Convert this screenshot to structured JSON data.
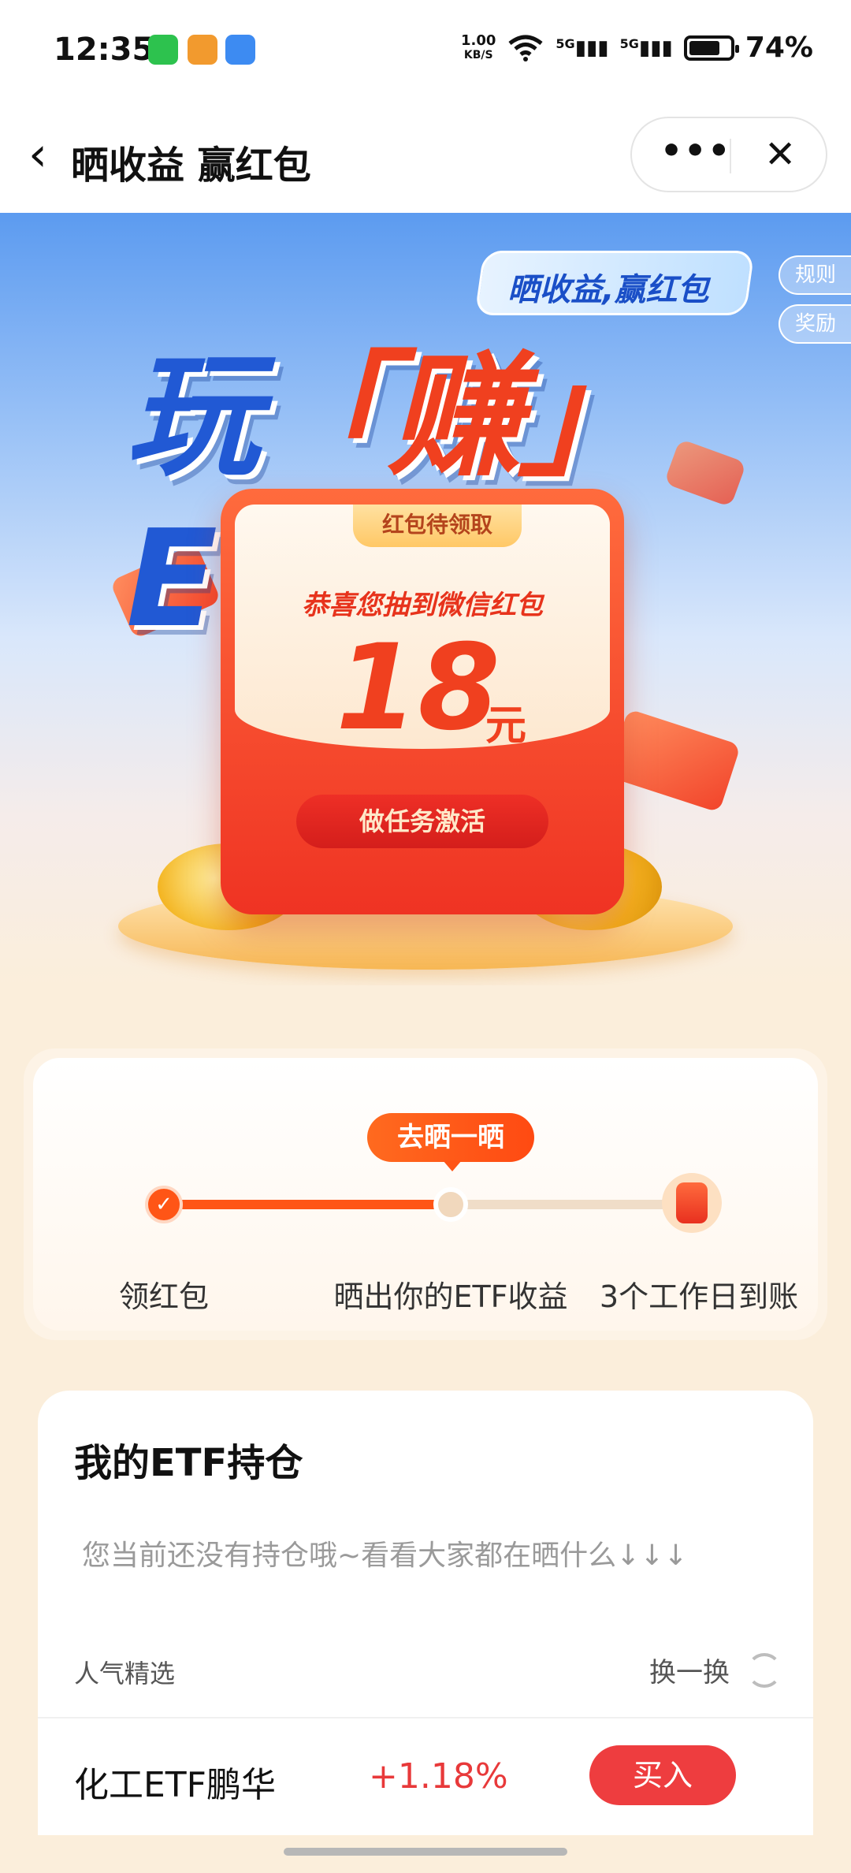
{
  "status_bar": {
    "time": "12:35",
    "net_speed_value": "1.00",
    "net_speed_unit": "KB/S",
    "signal1": "5G",
    "signal2": "5G",
    "battery": "74%"
  },
  "nav": {
    "title": "晒收益 赢红包",
    "more": "•••",
    "close": "✕"
  },
  "hero": {
    "badge": "晒收益,赢红包",
    "rules": "规则",
    "rewards": "奖励",
    "title_prefix": "玩",
    "title_earn": "「赚」",
    "title_suffix": "ETF",
    "card_tab": "红包待领取",
    "card_subtitle": "恭喜您抽到微信红包",
    "amount": "18",
    "unit": "元",
    "activate_button": "做任务激活"
  },
  "progress": {
    "tooltip": "去晒一晒",
    "steps": [
      "领红包",
      "晒出你的ETF收益",
      "3个工作日到账"
    ]
  },
  "holdings": {
    "title": "我的ETF持仓",
    "empty_text": "您当前还没有持仓哦~看看大家都在晒什么↓↓↓"
  },
  "picks": {
    "header": "人气精选",
    "refresh": "换一换",
    "items": [
      {
        "name": "化工ETF鹏华",
        "change": "+1.18%",
        "action": "买入"
      }
    ]
  },
  "colors": {
    "accent": "#ff5516",
    "red": "#ee3d3f",
    "hero_blue": "#2159d4"
  }
}
